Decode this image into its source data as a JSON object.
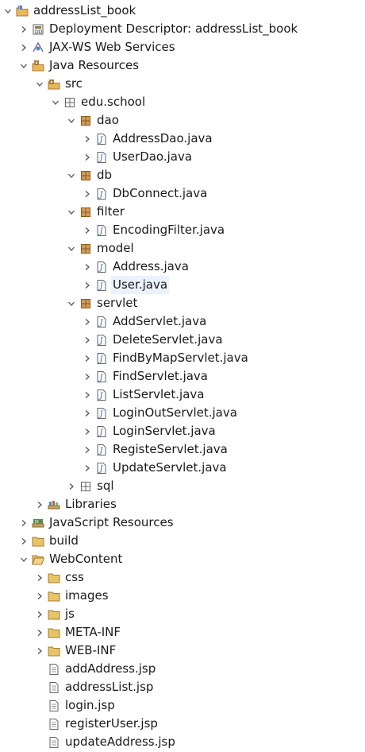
{
  "items": [
    {
      "label": "addressList_book",
      "expanded": true,
      "icon": "project-icon",
      "depth": 0
    },
    {
      "label": "Deployment Descriptor: addressList_book",
      "expanded": false,
      "icon": "deployment-descriptor-icon",
      "depth": 1
    },
    {
      "label": "JAX-WS Web Services",
      "expanded": false,
      "icon": "web-services-icon",
      "depth": 1
    },
    {
      "label": "Java Resources",
      "expanded": true,
      "icon": "java-resources-icon",
      "depth": 1
    },
    {
      "label": "src",
      "expanded": true,
      "icon": "source-folder-icon",
      "depth": 2
    },
    {
      "label": "edu.school",
      "expanded": true,
      "icon": "package-empty-icon",
      "depth": 3
    },
    {
      "label": "dao",
      "expanded": true,
      "icon": "package-icon",
      "depth": 4
    },
    {
      "label": "AddressDao.java",
      "expanded": false,
      "icon": "java-file-icon",
      "depth": 5
    },
    {
      "label": "UserDao.java",
      "expanded": false,
      "icon": "java-file-icon",
      "depth": 5
    },
    {
      "label": "db",
      "expanded": true,
      "icon": "package-icon",
      "depth": 4
    },
    {
      "label": "DbConnect.java",
      "expanded": false,
      "icon": "java-file-icon",
      "depth": 5
    },
    {
      "label": "filter",
      "expanded": true,
      "icon": "package-icon",
      "depth": 4
    },
    {
      "label": "EncodingFilter.java",
      "expanded": false,
      "icon": "java-file-icon",
      "depth": 5
    },
    {
      "label": "model",
      "expanded": true,
      "icon": "package-icon",
      "depth": 4
    },
    {
      "label": "Address.java",
      "expanded": false,
      "icon": "java-file-icon",
      "depth": 5
    },
    {
      "label": "User.java",
      "expanded": false,
      "icon": "java-file-icon",
      "depth": 5,
      "selected": true
    },
    {
      "label": "servlet",
      "expanded": true,
      "icon": "package-icon",
      "depth": 4
    },
    {
      "label": "AddServlet.java",
      "expanded": false,
      "icon": "java-file-icon",
      "depth": 5
    },
    {
      "label": "DeleteServlet.java",
      "expanded": false,
      "icon": "java-file-icon",
      "depth": 5
    },
    {
      "label": "FindByMapServlet.java",
      "expanded": false,
      "icon": "java-file-icon",
      "depth": 5
    },
    {
      "label": "FindServlet.java",
      "expanded": false,
      "icon": "java-file-icon",
      "depth": 5
    },
    {
      "label": "ListServlet.java",
      "expanded": false,
      "icon": "java-file-icon",
      "depth": 5
    },
    {
      "label": "LoginOutServlet.java",
      "expanded": false,
      "icon": "java-file-icon",
      "depth": 5
    },
    {
      "label": "LoginServlet.java",
      "expanded": false,
      "icon": "java-file-icon",
      "depth": 5
    },
    {
      "label": "RegisteServlet.java",
      "expanded": false,
      "icon": "java-file-icon",
      "depth": 5
    },
    {
      "label": "UpdateServlet.java",
      "expanded": false,
      "icon": "java-file-icon",
      "depth": 5
    },
    {
      "label": "sql",
      "expanded": false,
      "icon": "package-empty-icon",
      "depth": 4
    },
    {
      "label": "Libraries",
      "expanded": false,
      "icon": "libraries-icon",
      "depth": 2
    },
    {
      "label": "JavaScript Resources",
      "expanded": false,
      "icon": "javascript-resources-icon",
      "depth": 1
    },
    {
      "label": "build",
      "expanded": false,
      "icon": "folder-icon",
      "depth": 1
    },
    {
      "label": "WebContent",
      "expanded": true,
      "icon": "folder-open-icon",
      "depth": 1
    },
    {
      "label": "css",
      "expanded": false,
      "icon": "folder-icon",
      "depth": 2
    },
    {
      "label": "images",
      "expanded": false,
      "icon": "folder-icon",
      "depth": 2
    },
    {
      "label": "js",
      "expanded": false,
      "icon": "folder-icon",
      "depth": 2
    },
    {
      "label": "META-INF",
      "expanded": false,
      "icon": "folder-icon",
      "depth": 2
    },
    {
      "label": "WEB-INF",
      "expanded": false,
      "icon": "folder-icon",
      "depth": 2
    },
    {
      "label": "addAddress.jsp",
      "icon": "jsp-file-icon",
      "depth": 2
    },
    {
      "label": "addressList.jsp",
      "icon": "jsp-file-icon",
      "depth": 2
    },
    {
      "label": "login.jsp",
      "icon": "jsp-file-icon",
      "depth": 2
    },
    {
      "label": "registerUser.jsp",
      "icon": "jsp-file-icon",
      "depth": 2
    },
    {
      "label": "updateAddress.jsp",
      "icon": "jsp-file-icon",
      "depth": 2
    }
  ],
  "colors": {
    "selection": "#eaf3fd",
    "arrow": "#555555",
    "folder": "#e7b85a",
    "package": "#b07a3a",
    "java": "#3b6fb6"
  }
}
